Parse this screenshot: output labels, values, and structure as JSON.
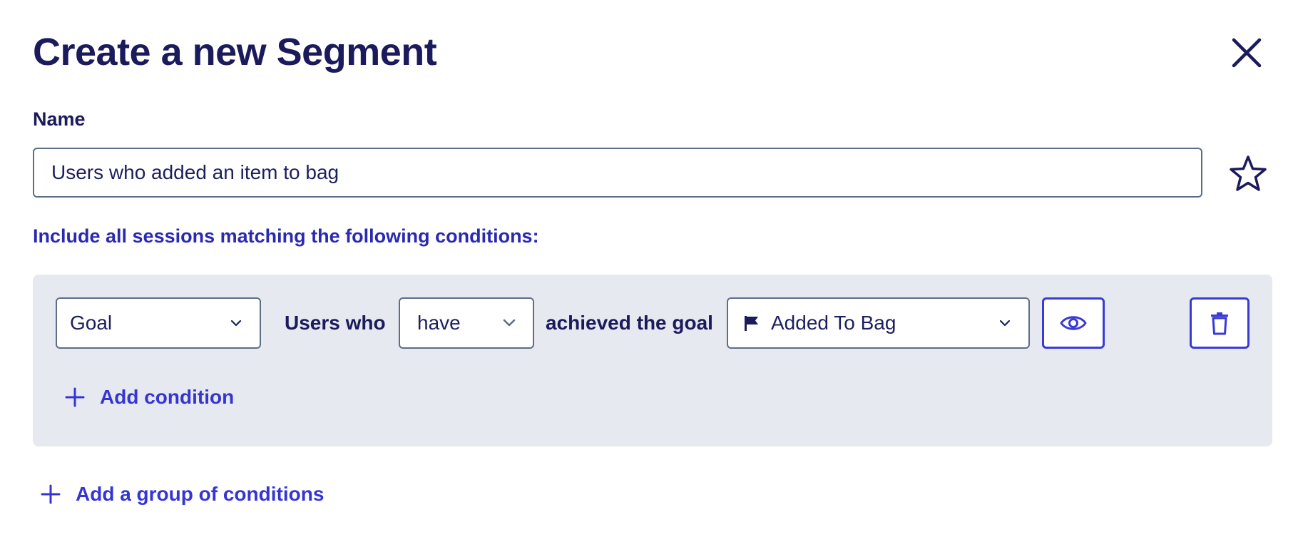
{
  "dialog": {
    "title": "Create a new Segment",
    "name_label": "Name",
    "name_value": "Users who added an item to bag",
    "include_text": "Include all sessions matching the following conditions:"
  },
  "condition": {
    "type_value": "Goal",
    "users_who_label": "Users who",
    "have_value": "have",
    "achieved_label": "achieved the goal",
    "goal_value": "Added To Bag",
    "goal_icon": "flag-icon",
    "preview_icon": "eye-icon",
    "delete_icon": "trash-icon"
  },
  "actions": {
    "add_condition": "Add condition",
    "add_group": "Add a group of conditions"
  },
  "colors": {
    "title": "#1a1a5c",
    "accent": "#3535d4",
    "include_text": "#2a2ab0",
    "group_bg": "#e6e9ef",
    "input_border": "#5e6e86"
  }
}
